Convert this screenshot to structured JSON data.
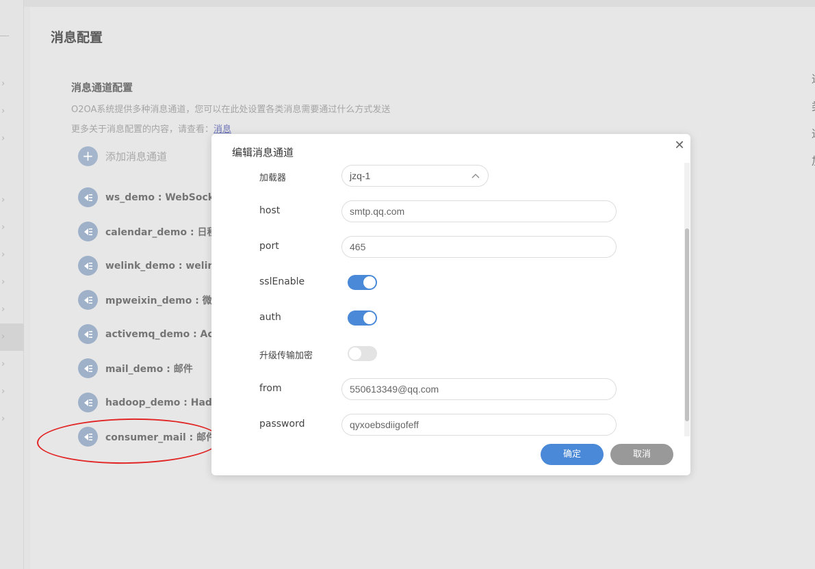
{
  "page": {
    "title": "消息配置",
    "section_title": "消息通道配置",
    "desc_line1": "O2OA系统提供多种消息通道，您可以在此处设置各类消息需要通过什么方式发送",
    "desc_line2_prefix": "更多关于消息配置的内容，请查看：",
    "desc_link": "消息",
    "add_channel_label": "添加消息通道"
  },
  "channels": [
    {
      "label": "ws_demo : WebSocket"
    },
    {
      "label": "calendar_demo : 日程"
    },
    {
      "label": "welink_demo : welink"
    },
    {
      "label": "mpweixin_demo : 微信"
    },
    {
      "label": "activemq_demo : Activ"
    },
    {
      "label": "mail_demo : 邮件"
    },
    {
      "label": "hadoop_demo : Hadoo"
    },
    {
      "label": "consumer_mail : 邮件"
    }
  ],
  "right_nav": [
    "通",
    "类",
    "通",
    "加"
  ],
  "dialog": {
    "title": "编辑消息通道",
    "fields": {
      "loader_label": "加载器",
      "loader_value": "jzq-1",
      "host_label": "host",
      "host_value": "smtp.qq.com",
      "port_label": "port",
      "port_value": "465",
      "ssl_label": "sslEnable",
      "ssl_on": true,
      "auth_label": "auth",
      "auth_on": true,
      "starttls_label": "升级传输加密",
      "starttls_on": false,
      "from_label": "from",
      "from_value": "550613349@qq.com",
      "password_label": "password",
      "password_value": "qyxoebsdiigofeff"
    },
    "ok_label": "确定",
    "cancel_label": "取消"
  },
  "colors": {
    "accent": "#4a88d8",
    "annotation": "#e22525"
  }
}
